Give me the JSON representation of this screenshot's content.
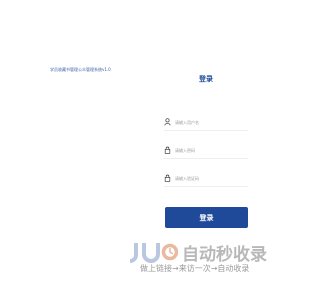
{
  "header": {
    "system_title": "学员收藏书管理公众管理系统v1.0"
  },
  "login": {
    "title": "登录",
    "username_placeholder": "请输入用户名",
    "password_placeholder": "请输入密码",
    "captcha_placeholder": "请输入验证码",
    "submit_label": "登录"
  },
  "watermark": {
    "name": "自动秒收录",
    "slogan": "做上链接→来访一次→自动收录",
    "color": "#b8b8b8"
  },
  "colors": {
    "accent": "#1f4a99",
    "title_text": "#3a63a8"
  },
  "icons": {
    "username": "user-icon",
    "password": "lock-icon",
    "captcha": "lock-icon"
  }
}
